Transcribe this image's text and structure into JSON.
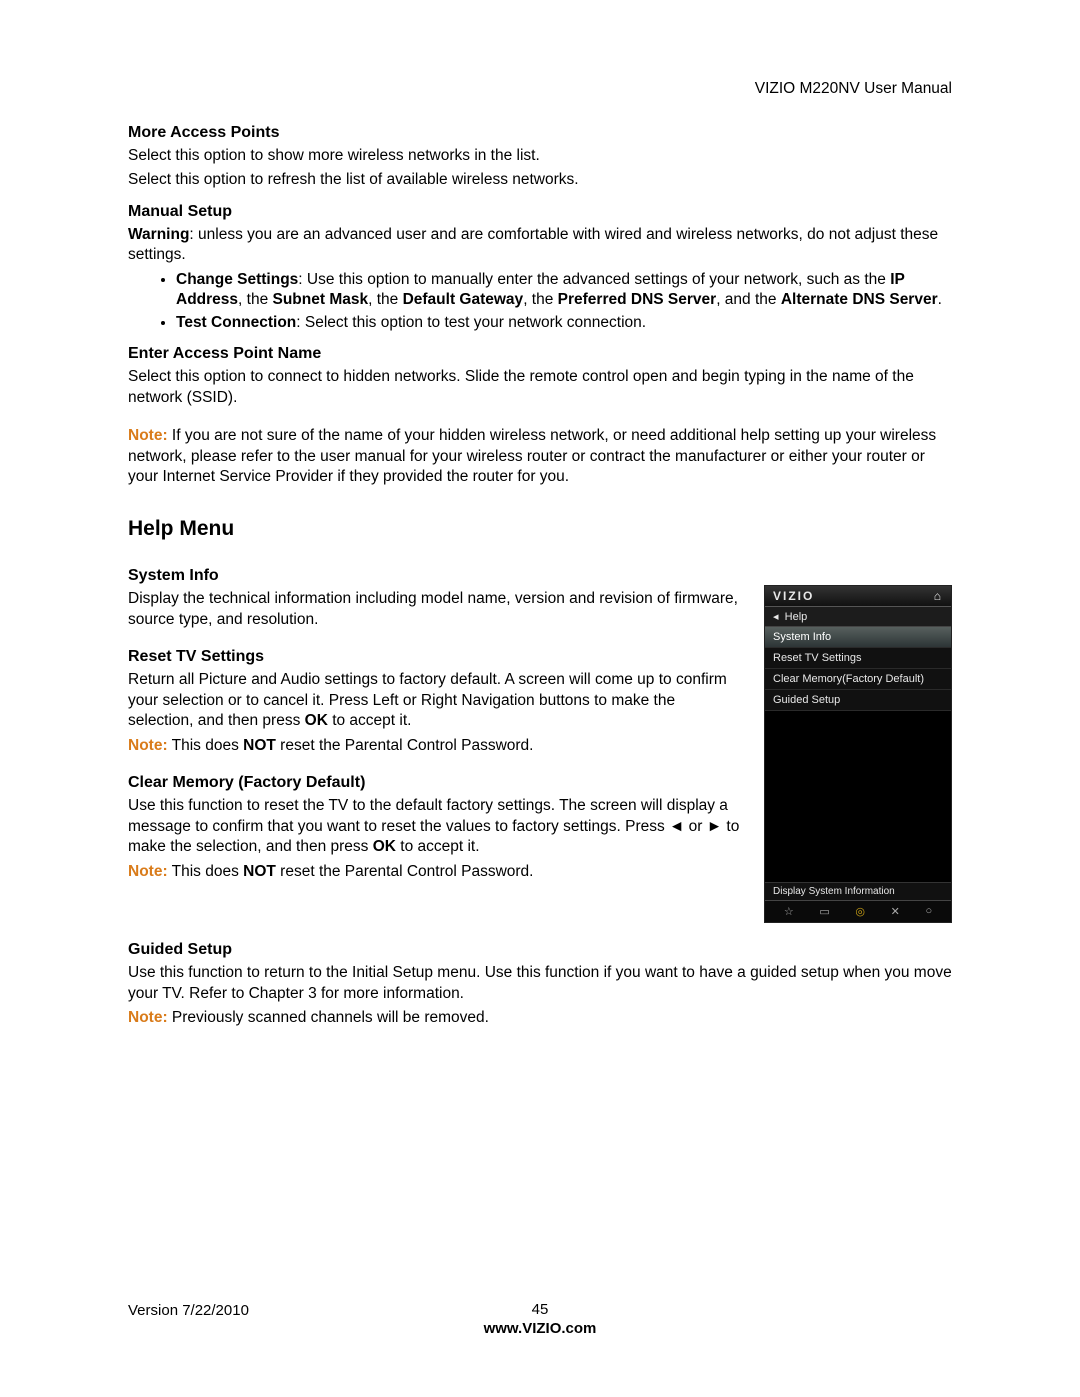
{
  "header": {
    "doc_title": "VIZIO M220NV User Manual"
  },
  "s1": {
    "h": "More Access Points",
    "p1": "Select this option to show more wireless networks in the list.",
    "p2": "Select this option to refresh the list of available wireless networks."
  },
  "s2": {
    "h": "Manual Setup",
    "warn_label": "Warning",
    "warn_text": ": unless you are an advanced user and are comfortable with wired and wireless networks, do not adjust these settings.",
    "b1_label": "Change Settings",
    "b1a": ": Use this option to manually enter the advanced settings of your network, such as the ",
    "b1_ip": "IP Address",
    "b1b": ", the ",
    "b1_mask": "Subnet Mask",
    "b1c": ", the ",
    "b1_gw": "Default Gateway",
    "b1d": ", the ",
    "b1_pdns": "Preferred DNS Server",
    "b1e": ", and the ",
    "b1_adns": "Alternate DNS Server",
    "b1f": ".",
    "b2_label": "Test Connection",
    "b2_text": ": Select this option to test your network connection."
  },
  "s3": {
    "h": "Enter Access Point Name",
    "p": "Select this option to connect to hidden networks. Slide the remote control open and begin typing in the name of the network (SSID)."
  },
  "note1_label": "Note:",
  "note1_text": " If you are not sure of the name of your hidden wireless network, or need additional help setting up your wireless network, please refer to the user manual for your wireless router or contract the manufacturer or either your router or your Internet Service Provider if they provided the router for you.",
  "help_h": "Help Menu",
  "sys": {
    "h": "System Info",
    "p": "Display the technical information including model name, version and revision of firmware, source type, and resolution."
  },
  "reset": {
    "h": "Reset TV Settings",
    "p1a": "Return all Picture and Audio settings to factory default. A screen will come up to confirm your selection or to cancel it. Press Left or Right Navigation buttons to make the selection, and then press ",
    "p1_ok": "OK",
    "p1b": " to accept it.",
    "note_label": "Note:",
    "note_a": " This does ",
    "note_not": "NOT",
    "note_b": " reset the Parental Control Password."
  },
  "clear": {
    "h": "Clear Memory (Factory Default)",
    "p1a": "Use this function to reset the TV to the default factory settings. The screen will display a message to confirm that you want to reset the values to factory settings. Press ◄ or ► to make the selection, and then press ",
    "p1_ok": "OK",
    "p1b": " to accept it.",
    "note_label": "Note:",
    "note_a": " This does ",
    "note_not": "NOT",
    "note_b": " reset the Parental Control Password."
  },
  "guided": {
    "h": "Guided Setup",
    "p": "Use this function to return to the Initial Setup menu. Use this function if you want to have a guided setup when you move your TV. Refer to Chapter 3 for more information.",
    "note_label": "Note:",
    "note_text": " Previously scanned channels will be removed."
  },
  "tv": {
    "brand": "VIZIO",
    "crumb_arrow": "◂",
    "crumb": "Help",
    "items": [
      "System Info",
      "Reset TV Settings",
      "Clear Memory(Factory Default)",
      "Guided Setup"
    ],
    "selected": 0,
    "footer_text": "Display System Information",
    "icons": [
      "☆",
      "▭",
      "◎",
      "✕",
      "○"
    ]
  },
  "footer": {
    "version": "Version 7/22/2010",
    "page": "45",
    "url": "www.VIZIO.com"
  }
}
